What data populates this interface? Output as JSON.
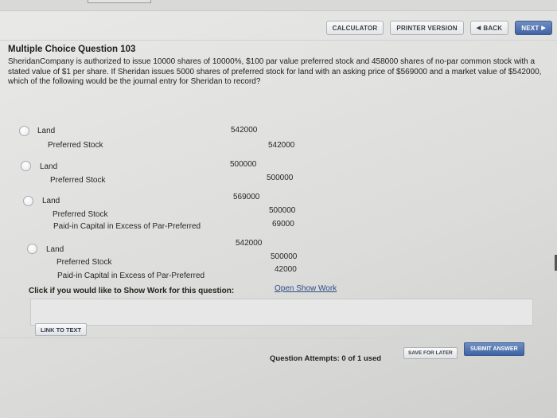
{
  "toolbar": {
    "calculator": "CALCULATOR",
    "printer_version": "PRINTER VERSION",
    "back": "BACK",
    "next": "NEXT"
  },
  "question": {
    "title": "Multiple Choice Question 103",
    "text": "SheridanCompany is authorized to issue 10000 shares of 10000%, $100 par value preferred stock and 458000 shares of no-par common stock with a stated value of $1 per share. If Sheridan issues 5000 shares of preferred stock for land with an asking price of $569000 and a market value of $542000, which of the following would be the journal entry for Sheridan to record?"
  },
  "options": [
    {
      "lines": [
        {
          "account": "Land",
          "debit": "542000",
          "credit": ""
        },
        {
          "account": "Preferred Stock",
          "debit": "",
          "credit": "542000"
        }
      ]
    },
    {
      "lines": [
        {
          "account": "Land",
          "debit": "500000",
          "credit": ""
        },
        {
          "account": "Preferred Stock",
          "debit": "",
          "credit": "500000"
        }
      ]
    },
    {
      "lines": [
        {
          "account": "Land",
          "debit": "569000",
          "credit": ""
        },
        {
          "account": "Preferred Stock",
          "debit": "",
          "credit": "500000"
        },
        {
          "account": "Paid-in Capital in Excess of Par-Preferred",
          "debit": "",
          "credit": "69000"
        }
      ]
    },
    {
      "lines": [
        {
          "account": "Land",
          "debit": "542000",
          "credit": ""
        },
        {
          "account": "Preferred Stock",
          "debit": "",
          "credit": "500000"
        },
        {
          "account": "Paid-in Capital in Excess of Par-Preferred",
          "debit": "",
          "credit": "42000"
        }
      ]
    }
  ],
  "show_work": {
    "prompt": "Click if you would like to Show Work for this question:",
    "link": "Open Show Work"
  },
  "link_to_text": "LINK TO TEXT",
  "footer": {
    "attempts": "Question Attempts: 0 of 1 used",
    "save_for_later": "SAVE FOR LATER",
    "submit_answer": "SUBMIT ANSWER"
  }
}
